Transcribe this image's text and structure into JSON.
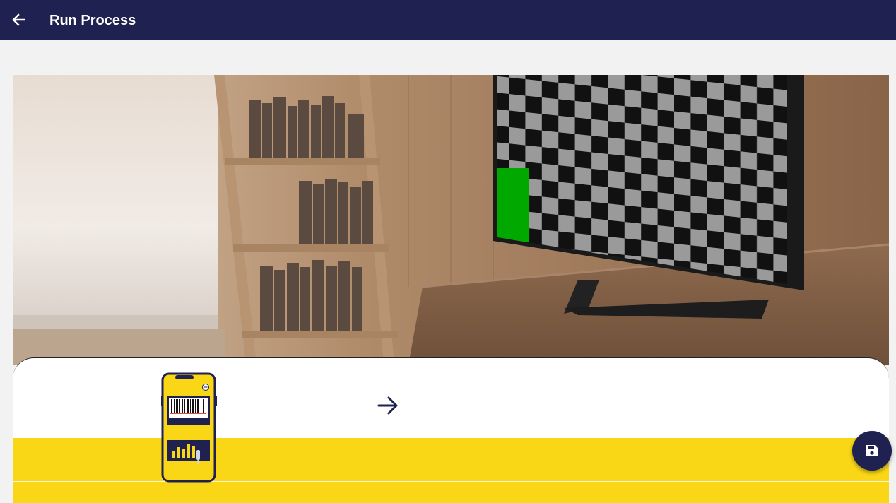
{
  "appbar": {
    "title": "Run Process",
    "back_icon": "arrow-back-icon"
  },
  "scene": {
    "description_icon": "living-room-tv-checkerboard-illustration"
  },
  "panel": {
    "phone_icon": "phone-barcode-scanner-icon",
    "arrow_icon": "arrow-right-icon"
  },
  "fab": {
    "icon": "save-icon"
  },
  "colors": {
    "primary": "#1f2150",
    "accent_yellow": "#fad716",
    "background": "#f2f2f2",
    "highlight_green": "#00a800"
  }
}
